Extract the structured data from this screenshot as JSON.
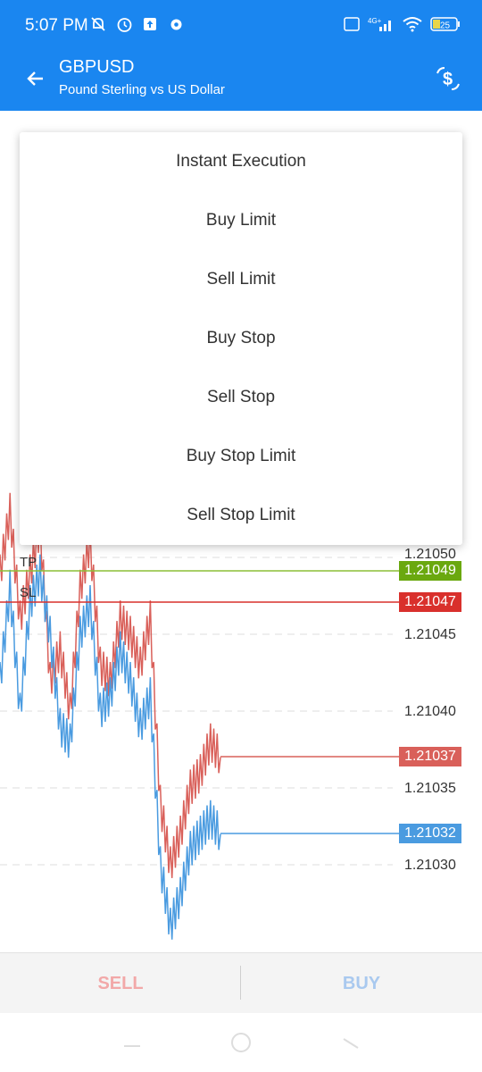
{
  "status_bar": {
    "time": "5:07 PM",
    "battery": "25",
    "network": "4G+",
    "icons_left": [
      "mute-bell-icon",
      "alarm-icon",
      "upload-icon",
      "settings-icon"
    ],
    "icons_right": [
      "volte-icon",
      "signal-icon",
      "wifi-icon",
      "battery-icon"
    ]
  },
  "app_bar": {
    "symbol": "GBPUSD",
    "description": "Pound Sterling vs US Dollar"
  },
  "order_menu": {
    "items": [
      "Instant Execution",
      "Buy Limit",
      "Sell Limit",
      "Buy Stop",
      "Sell Stop",
      "Buy Stop Limit",
      "Sell Stop Limit"
    ]
  },
  "chart": {
    "price_labels": [
      "1.21050",
      "1.21045",
      "1.21040",
      "1.21035",
      "1.21030"
    ],
    "tp": {
      "label": "TP",
      "price": "1.21049",
      "color": "#6aa80f"
    },
    "sl": {
      "label": "SL",
      "price": "1.21047",
      "color": "#d9302c"
    },
    "bid": {
      "price": "1.21037",
      "color": "#d9605a"
    },
    "ask": {
      "price": "1.21032",
      "color": "#4a9be0"
    }
  },
  "chart_data": {
    "type": "line",
    "ylim": [
      1.21027,
      1.21053
    ],
    "series": [
      {
        "values": [
          1.21049,
          1.21053,
          1.21046,
          1.21049,
          1.21052,
          1.21042,
          1.21044,
          1.2104,
          1.21048,
          1.21051,
          1.21043,
          1.21042,
          1.21046,
          1.21045,
          1.21043,
          1.21046,
          1.21034,
          1.2103,
          1.21032,
          1.21035,
          1.21036,
          1.21038,
          1.21037
        ]
      },
      {
        "values": [
          1.21042,
          1.21048,
          1.2104,
          1.21047,
          1.21049,
          1.21045,
          1.21039,
          1.21038,
          1.21045,
          1.21047,
          1.2104,
          1.21041,
          1.21044,
          1.21042,
          1.21039,
          1.21041,
          1.2103,
          1.21026,
          1.21028,
          1.21031,
          1.21032,
          1.21033,
          1.21032
        ]
      }
    ]
  },
  "bottom": {
    "sell_label": "SELL",
    "buy_label": "BUY"
  }
}
